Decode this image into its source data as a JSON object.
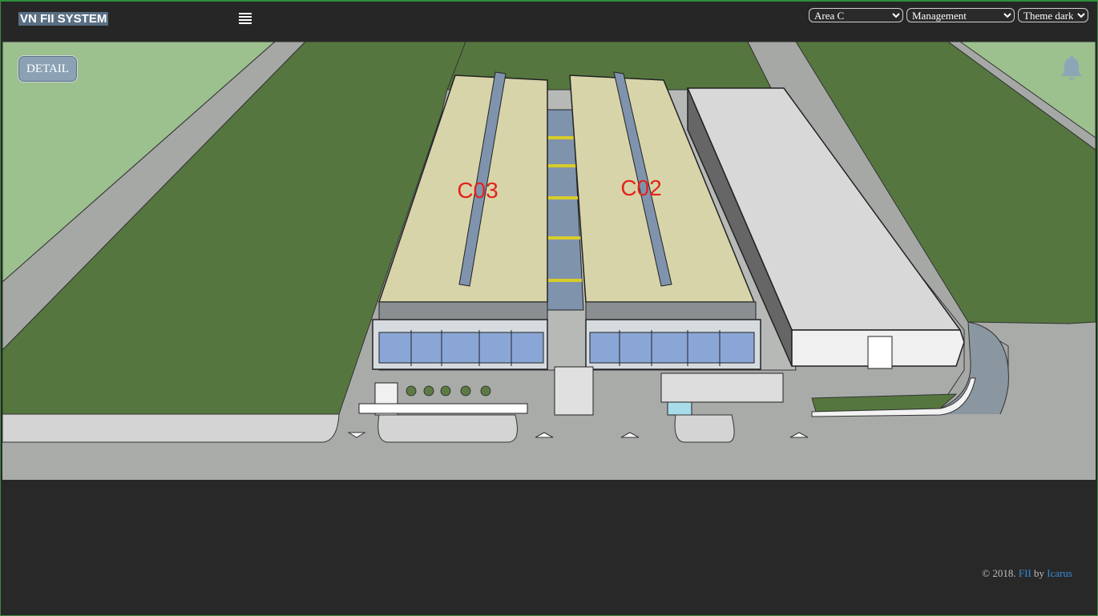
{
  "header": {
    "brand": "VN FII SYSTEM",
    "area_select": {
      "value": "Area C",
      "options": [
        "Area C"
      ]
    },
    "view_select": {
      "value": "Management",
      "options": [
        "Management"
      ]
    },
    "theme_select": {
      "value": "Theme dark",
      "options": [
        "Theme dark"
      ]
    }
  },
  "main": {
    "detail_button": "DETAIL",
    "buildings": {
      "left_label": "C03",
      "right_label": "C02"
    }
  },
  "footer": {
    "copyright": "© 2018.",
    "link1": "FII",
    "by": "by",
    "link2": "Icarus"
  },
  "colors": {
    "grass": "#55773f",
    "light_grass": "#9cc08e",
    "road": "#a9aba9",
    "roof": "#d8d4aa",
    "label": "#e2231a",
    "bell": "#8ca6b8"
  }
}
